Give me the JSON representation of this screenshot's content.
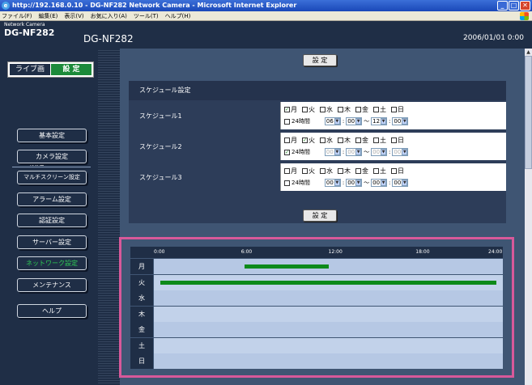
{
  "browser": {
    "title": "http://192.168.0.10 - DG-NF282 Network Camera - Microsoft Internet Explorer",
    "menu": [
      "ファイル(F)",
      "編集(E)",
      "表示(V)",
      "お気に入り(A)",
      "ツール(T)",
      "ヘルプ(H)"
    ]
  },
  "header": {
    "brand_small": "Network Camera",
    "brand_big": "DG-NF282",
    "model": "DG-NF282",
    "datetime": "2006/01/01  0:00"
  },
  "sidebar": {
    "live_label": "ライブ画",
    "setup_label": "設 定",
    "menu_title": "設定メニュー",
    "items": [
      {
        "label": "基本設定"
      },
      {
        "label": "カメラ設定"
      },
      {
        "label": "マルチスクリーン設定"
      },
      {
        "label": "アラーム設定"
      },
      {
        "label": "認証設定"
      },
      {
        "label": "サーバー設定"
      },
      {
        "label": "ネットワーク設定",
        "active": true
      },
      {
        "label": "メンテナンス"
      },
      {
        "label": "ヘルプ"
      }
    ]
  },
  "main": {
    "setup_button": "設 定",
    "schedule_title": "スケジュール設定",
    "day_labels": [
      "月",
      "火",
      "水",
      "木",
      "金",
      "土",
      "日"
    ],
    "all_day_label": "24時間",
    "tilde": "～",
    "colon": ":",
    "schedules": [
      {
        "label": "スケジュール1",
        "days_checked": [
          true,
          false,
          false,
          false,
          false,
          false,
          false
        ],
        "all_day": false,
        "start_h": "06",
        "start_m": "00",
        "end_h": "12",
        "end_m": "00",
        "disabled": false
      },
      {
        "label": "スケジュール2",
        "days_checked": [
          false,
          true,
          false,
          false,
          false,
          false,
          false
        ],
        "all_day": true,
        "start_h": "00",
        "start_m": "00",
        "end_h": "00",
        "end_m": "00",
        "disabled": true
      },
      {
        "label": "スケジュール3",
        "days_checked": [
          false,
          false,
          false,
          false,
          false,
          false,
          false
        ],
        "all_day": false,
        "start_h": "00",
        "start_m": "00",
        "end_h": "00",
        "end_m": "00",
        "disabled": false
      }
    ]
  },
  "timeline": {
    "ticks": [
      "0:00",
      "6:00",
      "12:00",
      "18:00",
      "24:00"
    ],
    "days": [
      "月",
      "火",
      "水",
      "木",
      "金",
      "土",
      "日"
    ],
    "bars": [
      {
        "day": 0,
        "start": 6,
        "end": 12
      },
      {
        "day": 1,
        "start": 0,
        "end": 24
      }
    ],
    "bar_color": "#0d8a1a",
    "highlight_color": "#d8599a"
  }
}
